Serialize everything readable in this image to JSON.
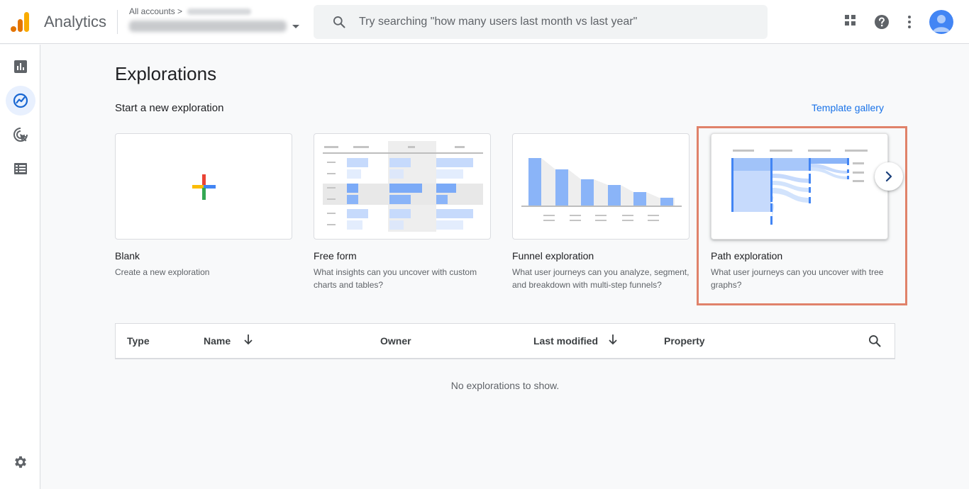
{
  "header": {
    "app_name": "Analytics",
    "account_crumb": "All accounts",
    "search_placeholder": "Try searching \"how many users last month vs last year\""
  },
  "sidenav": {
    "items": [
      "reports-icon",
      "explore-icon",
      "advertising-icon",
      "configure-icon"
    ],
    "settings": "settings-icon"
  },
  "main": {
    "title": "Explorations",
    "section_label": "Start a new exploration",
    "template_gallery": "Template gallery",
    "cards": [
      {
        "title": "Blank",
        "description": "Create a new exploration"
      },
      {
        "title": "Free form",
        "description": "What insights can you uncover with custom charts and tables?"
      },
      {
        "title": "Funnel exploration",
        "description": "What user journeys can you analyze, segment, and breakdown with multi-step funnels?"
      },
      {
        "title": "Path exploration",
        "description": "What user journeys can you uncover with tree graphs?"
      }
    ]
  },
  "table": {
    "columns": [
      "Type",
      "Name",
      "Owner",
      "Last modified",
      "Property"
    ],
    "empty_message": "No explorations to show."
  },
  "colors": {
    "accent": "#1a73e8",
    "highlight_border": "#e0826a",
    "chart_blue": "#8ab4f8",
    "chart_blue_light": "#d2e3fc"
  }
}
